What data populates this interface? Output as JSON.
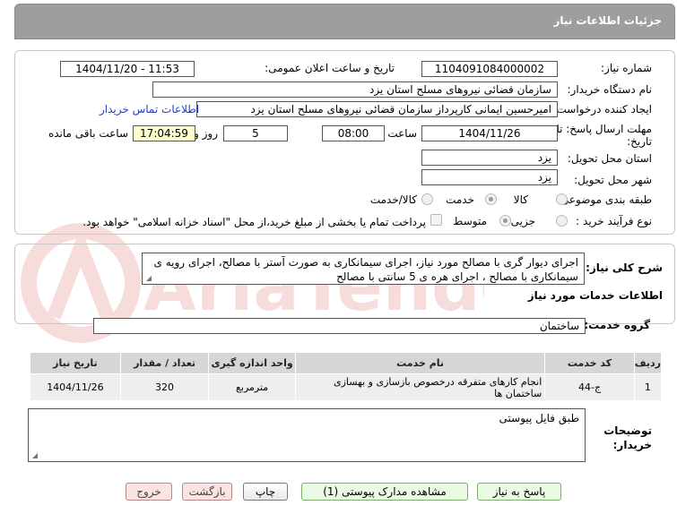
{
  "header": {
    "title": "جزئیات اطلاعات نیاز"
  },
  "fields": {
    "need_number_label": "شماره نیاز:",
    "need_number": "1104091084000002",
    "announce_label": "تاریخ و ساعت اعلان عمومی:",
    "announce_value": "1404/11/20 - 11:53",
    "buyer_org_label": "نام دستگاه خریدار:",
    "buyer_org": "سازمان قضائی نیروهای مسلح استان یزد",
    "creator_label": "ایجاد کننده درخواست:",
    "creator": "امیرحسین ایمانی کارپرداز سازمان قضائی نیروهای مسلح استان یزد",
    "contact_link": "اطلاعات تماس خریدار",
    "deadline_label_1": "مهلت ارسال پاسخ: تا",
    "deadline_label_2": "تاریخ:",
    "deadline_date": "1404/11/26",
    "time_label": "ساعت",
    "deadline_time": "08:00",
    "days_value": "5",
    "days_label": "روز و",
    "remaining_time": "17:04:59",
    "remaining_label": "ساعت باقی مانده",
    "province_label": "استان محل تحویل:",
    "province": "یزد",
    "city_label": "شهر محل تحویل:",
    "city": "یزد",
    "category_label": "طبقه بندی موضوعی:",
    "category_options": [
      "کالا",
      "خدمت",
      "کالا/خدمت"
    ],
    "process_label": "نوع فرآیند خرید :",
    "process_options": [
      "جزیی",
      "متوسط"
    ],
    "payment_note": "پرداخت تمام یا بخشی از مبلغ خرید،از محل \"اسناد خزانه اسلامی\" خواهد بود."
  },
  "description": {
    "label": "شرح کلی نیاز:",
    "text": "اجرای دیوار گری با مصالح مورد نیاز، اجرای سیمانکاری به صورت آستر با مصالح، اجرای رویه ی سیمانکاری با مصالح ، اجرای هره ی 5 سانتی با مصالح"
  },
  "services": {
    "section_title": "اطلاعات خدمات مورد نیاز",
    "group_label": "گروه خدمت:",
    "group_value": "ساختمان",
    "columns": [
      "ردیف",
      "کد خدمت",
      "نام خدمت",
      "واحد اندازه گیری",
      "تعداد / مقدار",
      "تاریخ نیاز"
    ],
    "rows": [
      [
        "1",
        "ج-44",
        "انجام کارهای متفرقه درخصوص بازسازی و بهسازی ساختمان ها",
        "مترمربع",
        "320",
        "1404/11/26"
      ]
    ]
  },
  "notes": {
    "label_1": "توضیحات",
    "label_2": "خریدار:",
    "text": "طبق فایل پیوستی"
  },
  "buttons": {
    "respond": "پاسخ به نیاز",
    "attachments": "مشاهده مدارک پیوستی (1)",
    "print": "چاپ",
    "back": "بازگشت",
    "exit": "خروج"
  },
  "watermark": {
    "text": "AriaTender.net"
  },
  "colors": {
    "header": "#9e9e9e",
    "time_highlight": "#ffffcc",
    "link": "#1a3fd6",
    "watermark": "#d22f2f"
  }
}
